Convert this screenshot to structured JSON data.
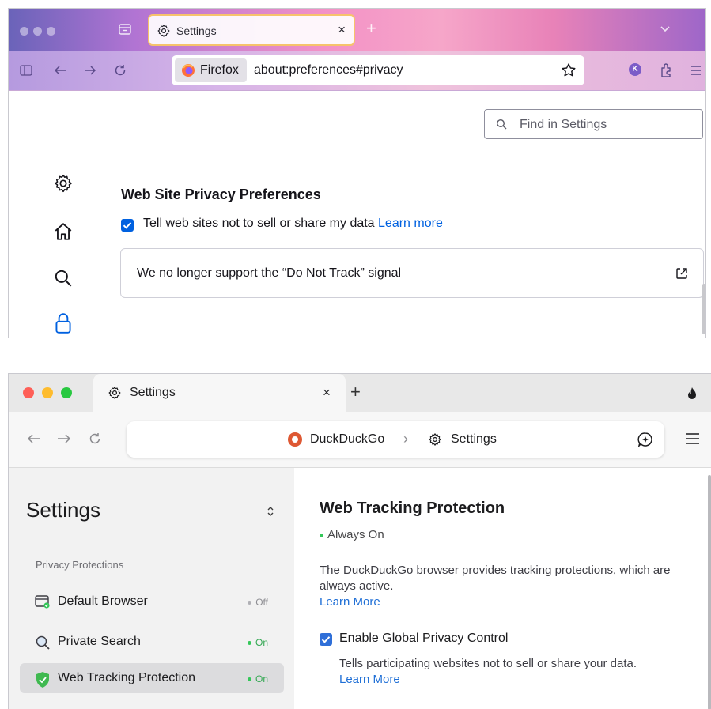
{
  "firefox": {
    "tab": {
      "title": "Settings",
      "close": "×"
    },
    "newtab": "+",
    "url": {
      "identity_label": "Firefox",
      "address": "about:preferences#privacy"
    },
    "avatar_letter": "K",
    "find_placeholder": "Find in Settings",
    "section_heading": "Web Site Privacy Preferences",
    "checkbox_label": "Tell web sites not to sell or share my data",
    "checkbox_checked": true,
    "learn_more": "Learn more",
    "dnt_notice": "We no longer support the “Do Not Track” signal",
    "sidebar_icons": [
      "gear-icon",
      "home-icon",
      "search-icon",
      "lock-icon"
    ],
    "colors": {
      "link": "#0061e0",
      "tab_highlight": "#f6c36b"
    }
  },
  "ddg": {
    "tab": {
      "title": "Settings",
      "close": "×"
    },
    "newtab": "+",
    "address": {
      "site": "DuckDuckGo",
      "separator": "›",
      "page": "Settings"
    },
    "sidebar": {
      "title": "Settings",
      "section": "Privacy Protections",
      "items": [
        {
          "label": "Default Browser",
          "status": "Off",
          "icon": "browser-icon"
        },
        {
          "label": "Private Search",
          "status": "On",
          "icon": "magnifier-icon"
        },
        {
          "label": "Web Tracking Protection",
          "status": "On",
          "icon": "shield-icon",
          "selected": true
        }
      ]
    },
    "main": {
      "heading": "Web Tracking Protection",
      "status": "Always On",
      "description": "The DuckDuckGo browser provides tracking protections, which are always active.",
      "learn_more": "Learn More",
      "gpc": {
        "label": "Enable Global Privacy Control",
        "checked": true,
        "description": "Tells participating websites not to sell or share your data.",
        "learn_more": "Learn More"
      }
    },
    "colors": {
      "on": "#34c759",
      "off": "#b0b0b5",
      "link": "#1f6fd6",
      "brand": "#de5833"
    }
  }
}
